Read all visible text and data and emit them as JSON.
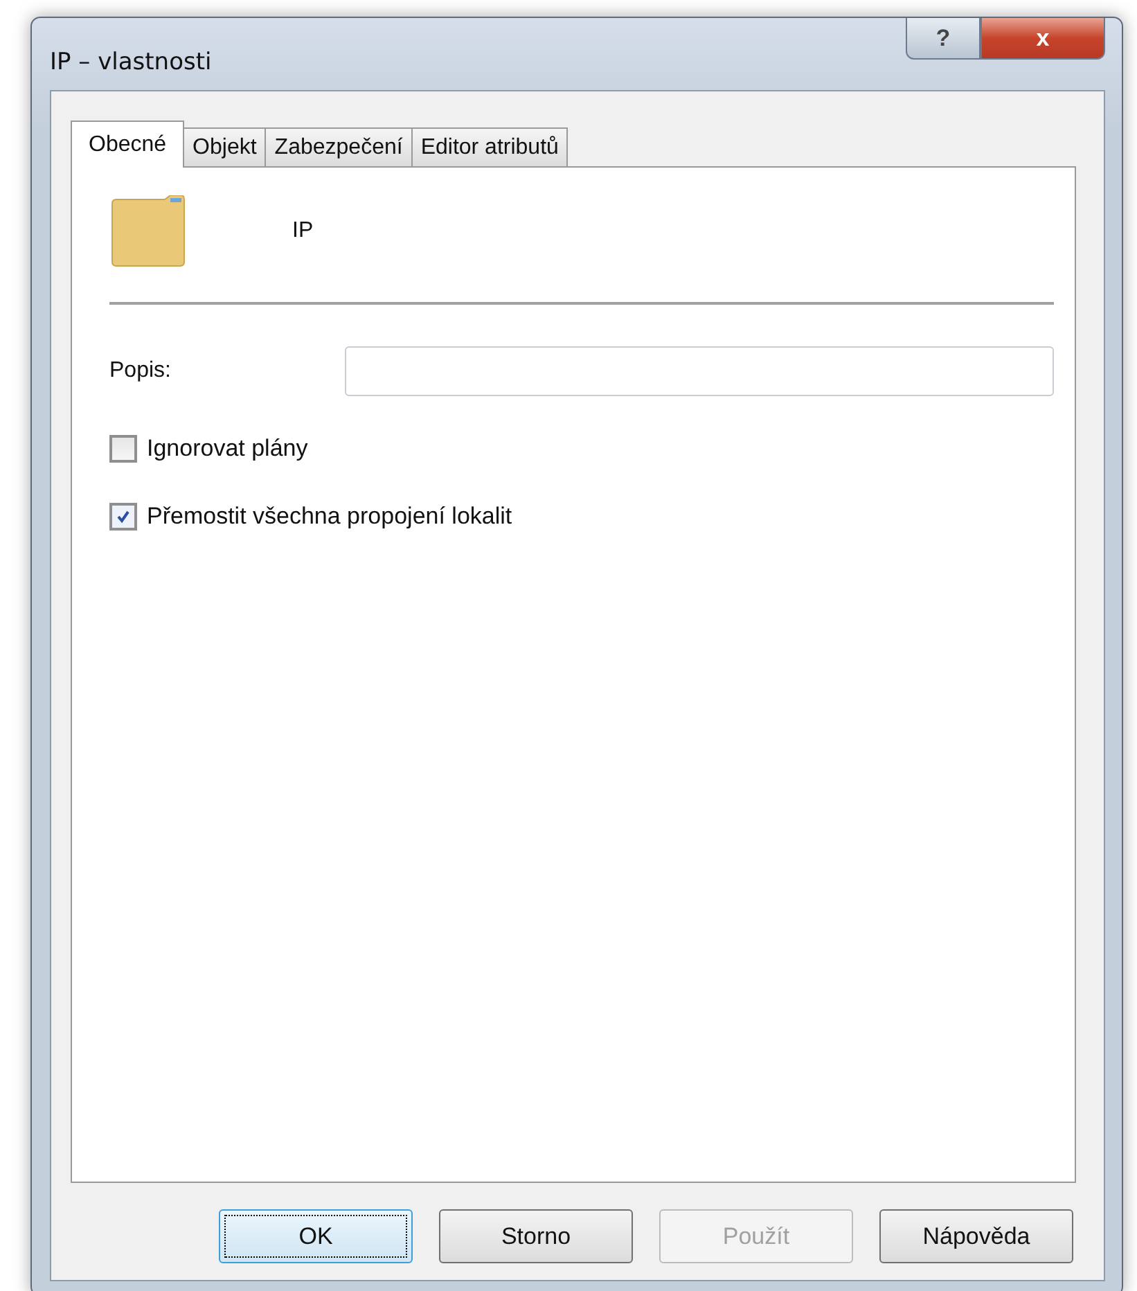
{
  "window": {
    "title": "IP – vlastnosti",
    "help_button": "?",
    "close_button": "x"
  },
  "tabs": [
    {
      "label": "Obecné",
      "selected": true
    },
    {
      "label": "Objekt",
      "selected": false
    },
    {
      "label": "Zabezpečení",
      "selected": false
    },
    {
      "label": "Editor atributů",
      "selected": false
    }
  ],
  "object_name": "IP",
  "description": {
    "label": "Popis:"
  },
  "checkboxes": [
    {
      "label": "Ignorovat plány",
      "checked": false
    },
    {
      "label": "Přemostit všechna propojení lokalit",
      "checked": true
    }
  ],
  "buttons": [
    {
      "label": "OK",
      "default": true,
      "disabled": false
    },
    {
      "label": "Storno",
      "default": false,
      "disabled": false
    },
    {
      "label": "Použít",
      "default": false,
      "disabled": true
    },
    {
      "label": "Nápověda",
      "default": false,
      "disabled": false
    }
  ]
}
